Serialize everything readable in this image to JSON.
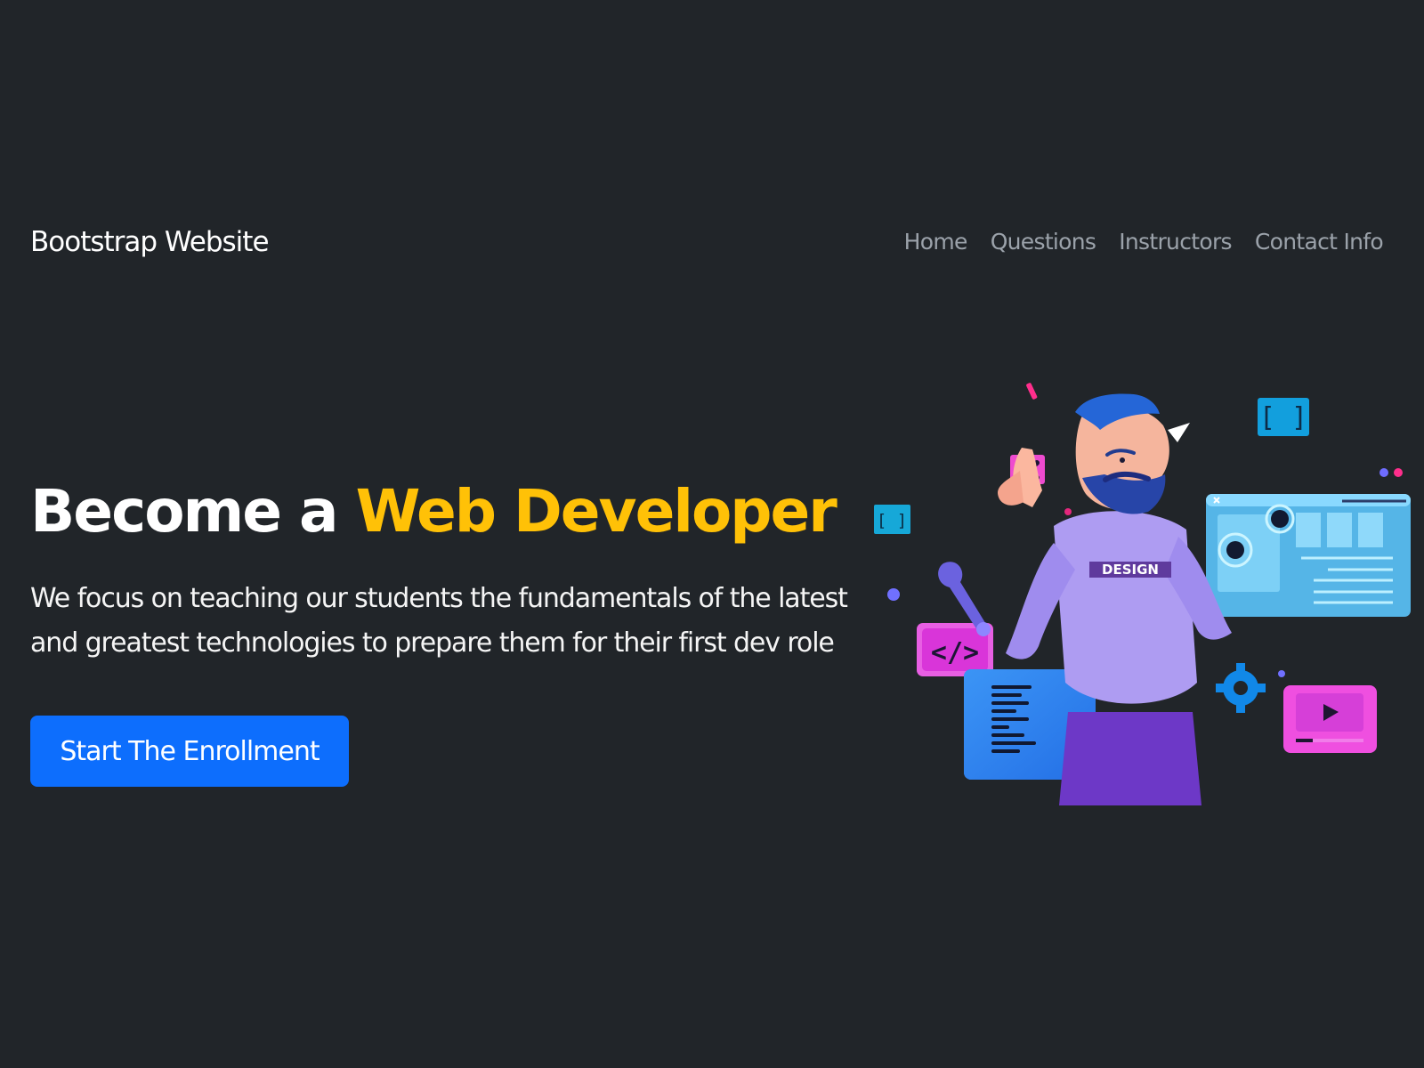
{
  "navbar": {
    "brand": "Bootstrap Website",
    "links": [
      {
        "label": "Home"
      },
      {
        "label": "Questions"
      },
      {
        "label": "Instructors"
      },
      {
        "label": "Contact Info"
      }
    ]
  },
  "hero": {
    "title_prefix": "Become a ",
    "title_highlight": "Web Developer",
    "description": "We focus on teaching our students the fundamentals of the latest and greatest technologies to prepare them for their first dev role",
    "button_label": "Start The Enrollment"
  },
  "illustration": {
    "shirt_text": "DESIGN",
    "icons": [
      "developer-character",
      "code-tag-icon",
      "bracket-icon",
      "close-icon",
      "wrench-icon",
      "gear-icon",
      "play-video-icon",
      "browser-window",
      "document-icon"
    ]
  },
  "colors": {
    "background": "#212529",
    "accent": "#ffc107",
    "primary_button": "#0d6efd",
    "nav_text": "#9ba2aa",
    "text": "#ffffff"
  }
}
